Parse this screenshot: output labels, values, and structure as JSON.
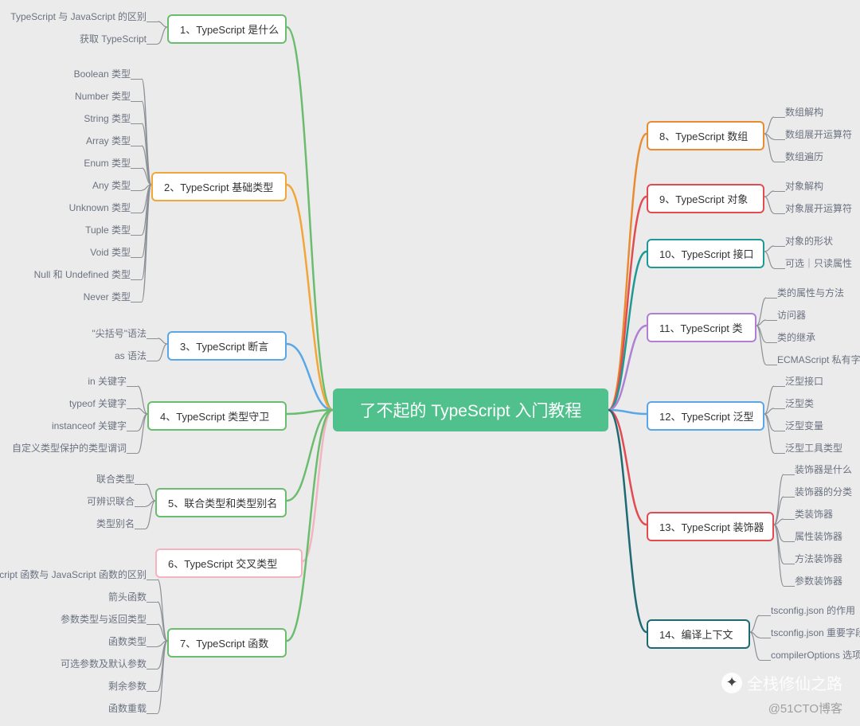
{
  "center": "了不起的 TypeScript 入门教程",
  "left_topics": [
    {
      "label": "1、TypeScript 是什么",
      "color": "#6bbd6e",
      "leaves": [
        "TypeScript 与 JavaScript 的区别",
        "获取 TypeScript"
      ]
    },
    {
      "label": "2、TypeScript 基础类型",
      "color": "#f0a638",
      "leaves": [
        "Boolean 类型",
        "Number 类型",
        "String 类型",
        "Array 类型",
        "Enum 类型",
        "Any 类型",
        "Unknown 类型",
        "Tuple 类型",
        "Void 类型",
        "Null 和 Undefined 类型",
        "Never 类型"
      ]
    },
    {
      "label": "3、TypeScript 断言",
      "color": "#5aa6e6",
      "leaves": [
        "\"尖括号\"语法",
        "as 语法"
      ]
    },
    {
      "label": "4、TypeScript 类型守卫",
      "color": "#6bbd6e",
      "leaves": [
        "in 关键字",
        "typeof 关键字",
        "instanceof 关键字",
        "自定义类型保护的类型谓词"
      ]
    },
    {
      "label": "5、联合类型和类型别名",
      "color": "#6bbd6e",
      "leaves": [
        "联合类型",
        "可辨识联合",
        "类型别名"
      ]
    },
    {
      "label": "6、TypeScript 交叉类型",
      "color": "#f3b3c0",
      "leaves": []
    },
    {
      "label": "7、TypeScript 函数",
      "color": "#6bbd6e",
      "leaves": [
        "TypeScript 函数与 JavaScript 函数的区别",
        "箭头函数",
        "参数类型与返回类型",
        "函数类型",
        "可选参数及默认参数",
        "剩余参数",
        "函数重载"
      ]
    }
  ],
  "right_topics": [
    {
      "label": "8、TypeScript 数组",
      "color": "#e88c30",
      "leaves": [
        "数组解构",
        "数组展开运算符",
        "数组遍历"
      ]
    },
    {
      "label": "9、TypeScript 对象",
      "color": "#e24b52",
      "leaves": [
        "对象解构",
        "对象展开运算符"
      ]
    },
    {
      "label": "10、TypeScript 接口",
      "color": "#1e9a94",
      "leaves": [
        "对象的形状",
        "可选｜只读属性"
      ]
    },
    {
      "label": "11、TypeScript 类",
      "color": "#b07fd3",
      "leaves": [
        "类的属性与方法",
        "访问器",
        "类的继承",
        "ECMAScript 私有字段"
      ]
    },
    {
      "label": "12、TypeScript 泛型",
      "color": "#5aa6e6",
      "leaves": [
        "泛型接口",
        "泛型类",
        "泛型变量",
        "泛型工具类型"
      ]
    },
    {
      "label": "13、TypeScript 装饰器",
      "color": "#e24b52",
      "leaves": [
        "装饰器是什么",
        "装饰器的分类",
        "类装饰器",
        "属性装饰器",
        "方法装饰器",
        "参数装饰器"
      ]
    },
    {
      "label": "14、编译上下文",
      "color": "#1e6a73",
      "leaves": [
        "tsconfig.json 的作用",
        "tsconfig.json 重要字段",
        "compilerOptions 选项"
      ]
    }
  ],
  "watermark1": "全栈修仙之路",
  "watermark2": "@51CTO博客"
}
